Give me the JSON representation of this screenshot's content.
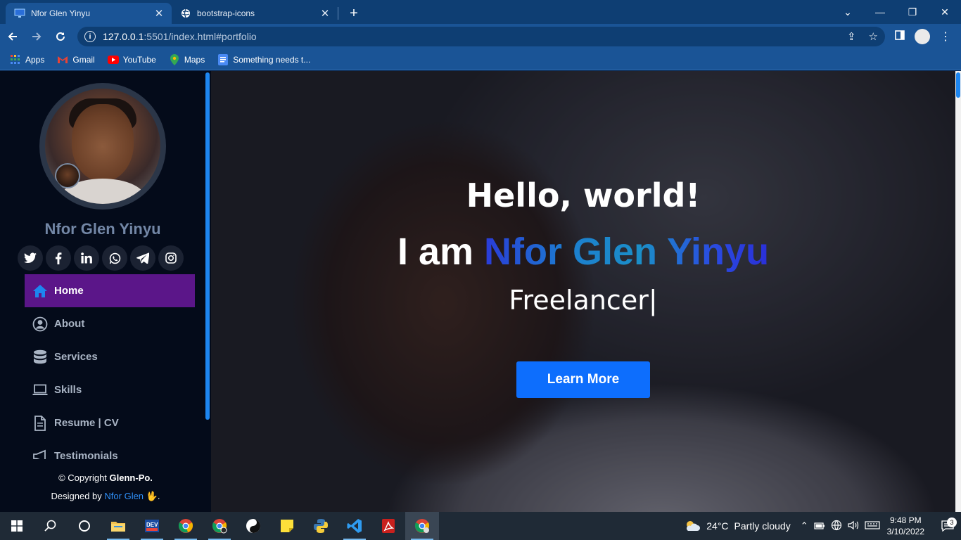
{
  "browser": {
    "tabs": [
      {
        "title": "Nfor Glen Yinyu",
        "active": true
      },
      {
        "title": "bootstrap-icons",
        "active": false
      }
    ],
    "new_tab_glyph": "+",
    "window_controls": {
      "minimize": "—",
      "maximize": "❐",
      "close": "✕"
    },
    "address": {
      "host": "127.0.0.1",
      "path": ":5501/index.html#portfolio"
    },
    "bookmarks": [
      "Apps",
      "Gmail",
      "YouTube",
      "Maps",
      "Something needs t..."
    ]
  },
  "sidebar": {
    "name": "Nfor Glen Yinyu",
    "socials": [
      "twitter-icon",
      "facebook-icon",
      "linkedin-icon",
      "whatsapp-icon",
      "telegram-icon",
      "instagram-icon"
    ],
    "nav": [
      {
        "label": "Home",
        "icon": "house-icon",
        "active": true
      },
      {
        "label": "About",
        "icon": "person-circle-icon",
        "active": false
      },
      {
        "label": "Services",
        "icon": "database-icon",
        "active": false
      },
      {
        "label": "Skills",
        "icon": "laptop-icon",
        "active": false
      },
      {
        "label": "Resume | CV",
        "icon": "file-icon",
        "active": false
      },
      {
        "label": "Testimonials",
        "icon": "megaphone-icon",
        "active": false
      }
    ],
    "footer": {
      "copyright_prefix": "© Copyright ",
      "copyright_brand": "Glenn-Po.",
      "designed_prefix": "Designed by ",
      "designed_link": "Nfor Glen",
      "designed_suffix": " 🖖."
    }
  },
  "hero": {
    "greeting": "Hello, world!",
    "iam_prefix": "I am ",
    "iam_name": "Nfor Glen Yinyu",
    "role": "Freelancer",
    "cursor": "|",
    "cta": "Learn More",
    "cta_color": "#0d6efd"
  },
  "taskbar": {
    "weather_temp": "24°C",
    "weather_text": "Partly cloudy",
    "time": "9:48 PM",
    "date": "3/10/2022",
    "notifications": "3"
  },
  "colors": {
    "active_nav": "#5b1689",
    "sidebar_bg": "#040b1a",
    "accent_blue": "#1d86f0"
  }
}
